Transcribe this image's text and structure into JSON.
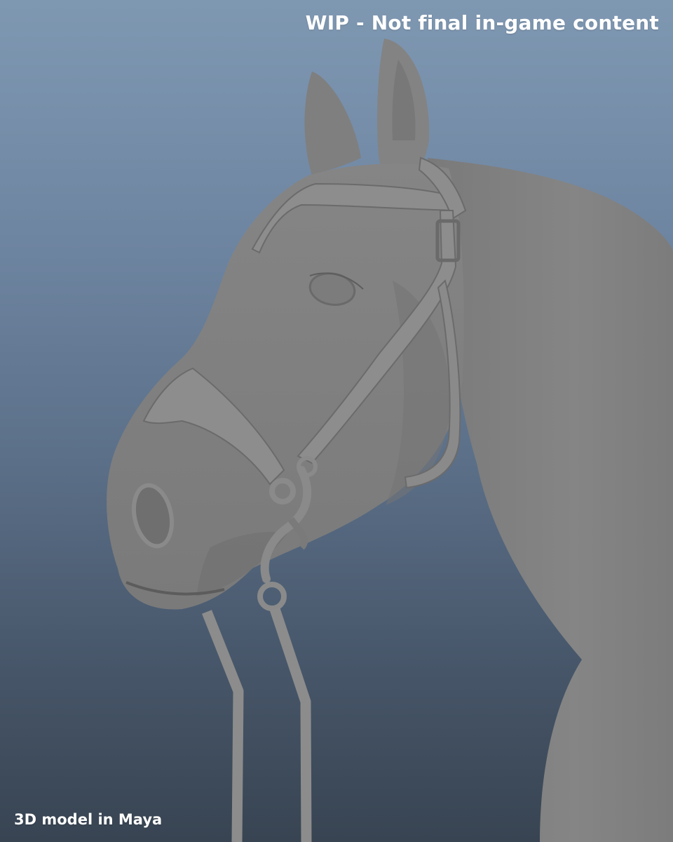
{
  "viewport": {
    "background_top": "#7f98b2",
    "background_bottom": "#384452",
    "model_color": "#808080",
    "tack_color": "#8c8c8c"
  },
  "render": {
    "subject": "horse-head-with-bridle"
  },
  "captions": {
    "top_right": "WIP - Not final in-game content",
    "bottom_left": "3D model in Maya"
  }
}
